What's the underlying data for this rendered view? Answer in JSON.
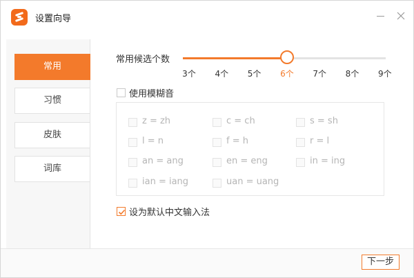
{
  "window": {
    "title": "设置向导",
    "icon": "app-logo-icon",
    "accent_color": "#f37a2b"
  },
  "sidebar": {
    "items": [
      {
        "label": "常用",
        "active": true
      },
      {
        "label": "习惯",
        "active": false
      },
      {
        "label": "皮肤",
        "active": false
      },
      {
        "label": "词库",
        "active": false
      }
    ]
  },
  "candidates": {
    "label": "常用候选个数",
    "ticks": [
      "3个",
      "4个",
      "5个",
      "6个",
      "7个",
      "8个",
      "9个"
    ],
    "selected_index": 3
  },
  "fuzzy": {
    "label": "使用模糊音",
    "checked": false,
    "options": [
      "z = zh",
      "c = ch",
      "s = sh",
      "l = n",
      "f = h",
      "r = l",
      "an = ang",
      "en = eng",
      "in = ing",
      "ian = iang",
      "uan = uang"
    ]
  },
  "default_ime": {
    "label": "设为默认中文输入法",
    "checked": true
  },
  "footer": {
    "next_label": "下一步"
  }
}
